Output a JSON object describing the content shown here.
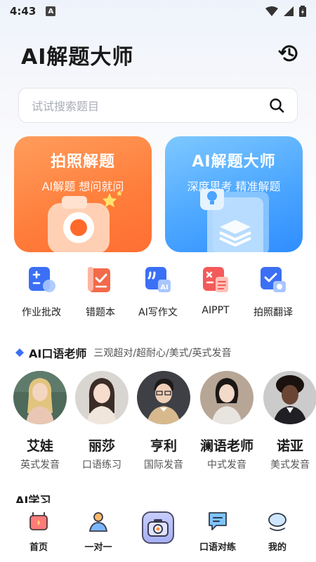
{
  "status_bar": {
    "time": "4:43",
    "notification_badge": "A"
  },
  "header": {
    "title": "AI解题大师"
  },
  "search": {
    "placeholder": "试试搜索题目"
  },
  "cards": [
    {
      "title": "拍照解题",
      "subtitle": "AI解题  想问就问",
      "color": "#ff7d3a"
    },
    {
      "title": "AI解题大师",
      "subtitle": "深度思考  精准解题",
      "color": "#3d97ff"
    }
  ],
  "tools": [
    {
      "label": "作业批改",
      "icon": "homework-check-icon"
    },
    {
      "label": "错题本",
      "icon": "mistake-book-icon"
    },
    {
      "label": "AI写作文",
      "icon": "ai-essay-icon"
    },
    {
      "label": "AIPPT",
      "icon": "ppt-icon"
    },
    {
      "label": "拍照翻译",
      "icon": "photo-translate-icon"
    }
  ],
  "teacher_section": {
    "title": "AI口语老师",
    "subtitle": "三观超对/超耐心/美式/英式发音"
  },
  "teachers": [
    {
      "name": "艾娃",
      "accent": "英式发音"
    },
    {
      "name": "丽莎",
      "accent": "口语练习"
    },
    {
      "name": "亨利",
      "accent": "国际发音"
    },
    {
      "name": "澜语老师",
      "accent": "中式发音"
    },
    {
      "name": "诺亚",
      "accent": "美式发音"
    }
  ],
  "next_section": {
    "title": "AI学习"
  },
  "bottom_nav": [
    {
      "label": "首页",
      "icon": "home-icon"
    },
    {
      "label": "一对一",
      "icon": "person-icon"
    },
    {
      "label": "",
      "icon": "camera-icon"
    },
    {
      "label": "口语对练",
      "icon": "chat-icon"
    },
    {
      "label": "我的",
      "icon": "profile-icon"
    }
  ]
}
